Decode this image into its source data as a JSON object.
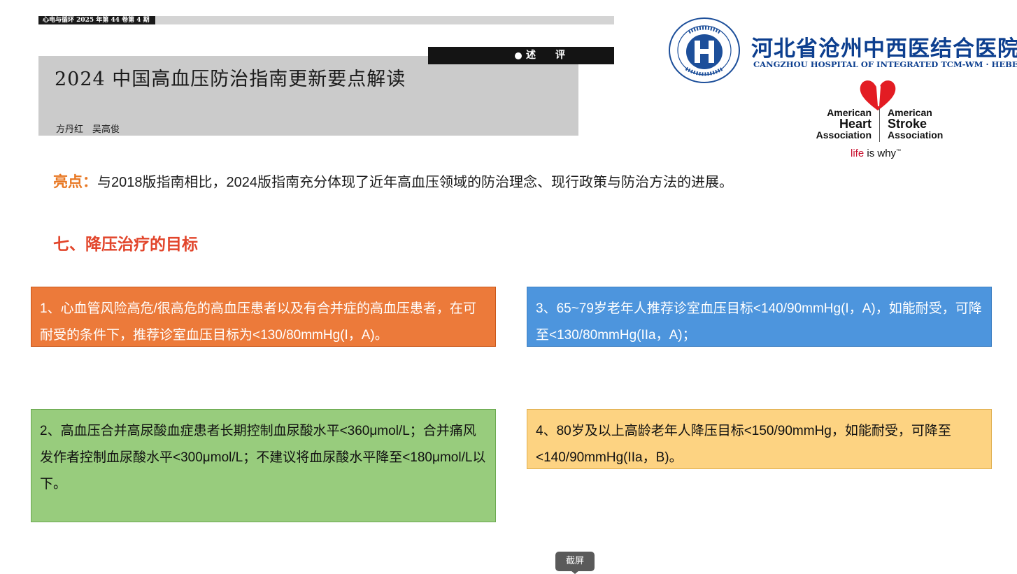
{
  "journal": {
    "issue": "心电与循环 2025 年第 44 卷第 4 期",
    "section": "述　　评"
  },
  "article": {
    "title": "2024 中国高血压防治指南更新要点解读",
    "authors": "方丹红　吴高俊"
  },
  "hospital": {
    "name_cn": "河北省沧州中西医结合医院",
    "name_en": "CANGZHOU HOSPITAL OF INTEGRATED TCM-WM · HEBEI",
    "emblem_name": "hospital-emblem-icon"
  },
  "aha": {
    "left_line1": "American",
    "left_line2": "Heart",
    "left_line3": "Association",
    "right_line1": "American",
    "right_line2": "Stroke",
    "right_line3": "Association",
    "tagline_red": "life",
    "tagline_rest": " is why"
  },
  "highlight": {
    "label": "亮点：",
    "text": "与2018版指南相比，2024版指南充分体现了近年高血压领域的防治理念、现行政策与防治方法的进展。"
  },
  "section_title": "七、降压治疗的目标",
  "cards": [
    {
      "text": "1、心血管风险高危/很高危的高血压患者以及有合并症的高血压患者，在可耐受的条件下，推荐诊室血压目标为<130/80mmHg(I，A)。",
      "color": "#ec7a3a"
    },
    {
      "text": "2、高血压合并高尿酸血症患者长期控制血尿酸水平<360μmol/L；合并痛风发作者控制血尿酸水平<300μmol/L；不建议将血尿酸水平降至<180μmol/L以下。",
      "color": "#98cc7d"
    },
    {
      "text": "3、65~79岁老年人推荐诊室血压目标<140/90mmHg(I，A)，如能耐受，可降至<130/80mmHg(IIa，A)；",
      "color": "#4d95dd"
    },
    {
      "text": "4、80岁及以上高龄老年人降压目标<150/90mmHg，如能耐受，可降至<140/90mmHg(IIa，B)。",
      "color": "#fdd382"
    }
  ],
  "tooltip": "截屏"
}
